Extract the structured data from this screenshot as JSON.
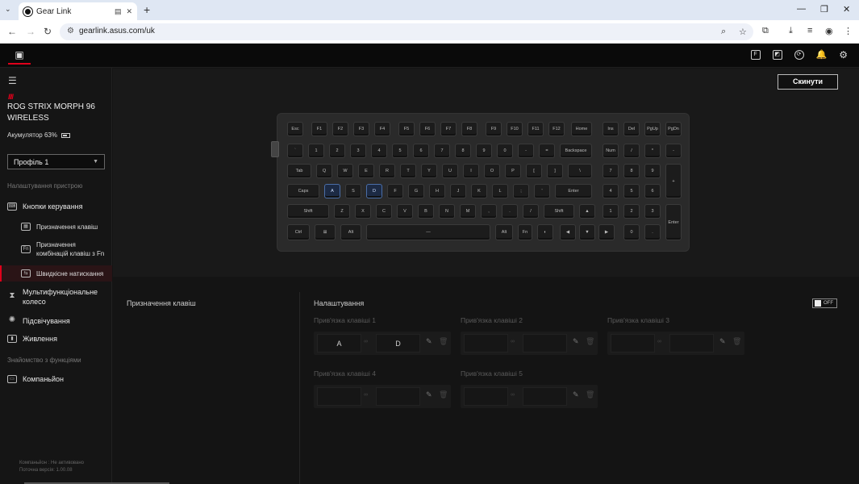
{
  "browser": {
    "tab_title": "Gear Link",
    "url": "gearlink.asus.com/uk"
  },
  "sidebar": {
    "device_name": "ROG STRIX MORPH 96 WIRELESS",
    "battery": "Акумулятор 63%",
    "battery_level": 0.63,
    "profile": "Профіль 1",
    "section_settings": "Налаштування пристрою",
    "section_features": "Знайомство з функціями",
    "items": [
      {
        "label": "Кнопки керування"
      },
      {
        "label": "Призначення клавіш"
      },
      {
        "label": "Призначення комбінацій клавіш з Fn"
      },
      {
        "label": "Швидкісне натискання"
      },
      {
        "label": "Мультифункціональне колесо"
      },
      {
        "label": "Підсвічування"
      },
      {
        "label": "Живлення"
      },
      {
        "label": "Компаньйон"
      }
    ],
    "footer_line1": "Компаньйон : Не активовано",
    "footer_line2": "Поточна версія: 1.00.08"
  },
  "toolbar": {
    "reset_label": "Скинути"
  },
  "keyboard": {
    "highlighted": [
      "A",
      "D"
    ]
  },
  "panel": {
    "assign_title": "Призначення клавіш",
    "settings_title": "Налаштування",
    "toggle_label": "OFF",
    "bindings": [
      {
        "label": "Прив'язка клавіші 1",
        "key1": "A",
        "key2": "D"
      },
      {
        "label": "Прив'язка клавіші 2",
        "key1": "",
        "key2": ""
      },
      {
        "label": "Прив'язка клавіші 3",
        "key1": "",
        "key2": ""
      },
      {
        "label": "Прив'язка клавіші 4",
        "key1": "",
        "key2": ""
      },
      {
        "label": "Прив'язка клавіші 5",
        "key1": "",
        "key2": ""
      }
    ]
  }
}
